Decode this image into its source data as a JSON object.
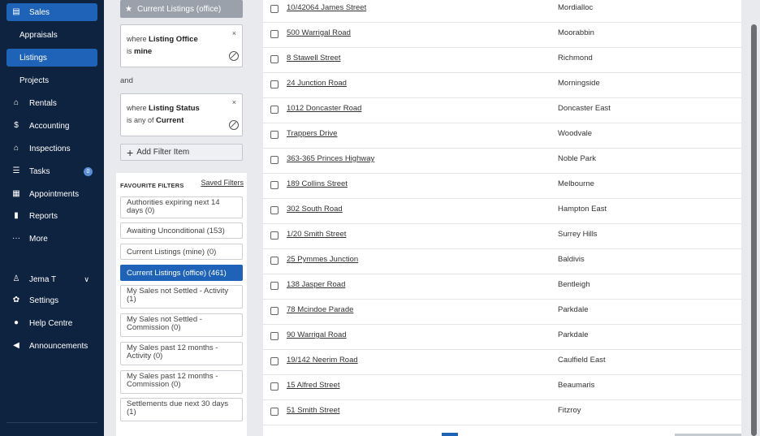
{
  "sidebar": {
    "items": [
      {
        "label": "Sales",
        "icon": "sales-icon",
        "glyph": "▤",
        "active": true
      },
      {
        "label": "Appraisals",
        "sub": true
      },
      {
        "label": "Listings",
        "sub": true,
        "active": true
      },
      {
        "label": "Projects",
        "sub": true
      },
      {
        "label": "Rentals",
        "icon": "home-icon",
        "glyph": "⌂"
      },
      {
        "label": "Accounting",
        "icon": "dollar-icon",
        "glyph": "$"
      },
      {
        "label": "Inspections",
        "icon": "inspection-icon",
        "glyph": "⌂"
      },
      {
        "label": "Tasks",
        "icon": "tasks-icon",
        "glyph": "☰",
        "badge": "0"
      },
      {
        "label": "Appointments",
        "icon": "calendar-icon",
        "glyph": "▦"
      },
      {
        "label": "Reports",
        "icon": "bar-chart-icon",
        "glyph": "▮"
      },
      {
        "label": "More",
        "icon": "ellipsis-icon",
        "glyph": "···"
      }
    ],
    "user": {
      "label": "Jema T",
      "icon": "user-icon",
      "glyph": "♙"
    },
    "settings": {
      "label": "Settings",
      "icon": "gear-icon",
      "glyph": "✿"
    },
    "help": {
      "label": "Help Centre",
      "icon": "help-icon",
      "glyph": "●"
    },
    "announcements": {
      "label": "Announcements",
      "icon": "megaphone-icon",
      "glyph": "◀"
    }
  },
  "filters": {
    "current_filter": "Current Listings (office)",
    "conditions": [
      {
        "where": "where",
        "field": "Listing Office",
        "op": "is",
        "value": "mine"
      },
      {
        "where": "where",
        "field": "Listing Status",
        "op": "is any of",
        "value": "Current"
      }
    ],
    "and_label": "and",
    "add_label": "Add Filter Item",
    "favourites_title": "FAVOURITE FILTERS",
    "saved_filters_link": "Saved Filters",
    "favourites": [
      {
        "label": "Authorities expiring next 14 days (0)"
      },
      {
        "label": "Awaiting Unconditional (153)"
      },
      {
        "label": "Current Listings (mine) (0)"
      },
      {
        "label": "Current Listings (office) (461)",
        "active": true
      },
      {
        "label": "My Sales not Settled - Activity (1)"
      },
      {
        "label": "My Sales not Settled - Commission (0)"
      },
      {
        "label": "My Sales past 12 months - Activity (0)"
      },
      {
        "label": "My Sales past 12 months - Commission (0)"
      },
      {
        "label": "Settlements due next 30 days (1)"
      }
    ]
  },
  "listings": [
    {
      "address": "10/42064 James Street",
      "suburb": "Mordialloc"
    },
    {
      "address": "500 Warrigal Road",
      "suburb": "Moorabbin"
    },
    {
      "address": "8 Stawell Street",
      "suburb": "Richmond"
    },
    {
      "address": "24 Junction Road",
      "suburb": "Morningside"
    },
    {
      "address": "1012 Doncaster Road",
      "suburb": "Doncaster East"
    },
    {
      "address": "Trappers Drive",
      "suburb": "Woodvale"
    },
    {
      "address": "363-365 Princes Highway",
      "suburb": "Noble Park"
    },
    {
      "address": "189 Collins Street",
      "suburb": "Melbourne"
    },
    {
      "address": "302 South Road",
      "suburb": "Hampton East"
    },
    {
      "address": "1/20 Smith Street",
      "suburb": "Surrey Hills"
    },
    {
      "address": "25 Pymmes Junction",
      "suburb": "Baldivis"
    },
    {
      "address": "138 Jasper Road",
      "suburb": "Bentleigh"
    },
    {
      "address": "78 Mcindoe Parade",
      "suburb": "Parkdale"
    },
    {
      "address": "90 Warrigal Road",
      "suburb": "Parkdale"
    },
    {
      "address": "19/142 Neerim Road",
      "suburb": "Caulfield East"
    },
    {
      "address": "15 Alfred Street",
      "suburb": "Beaumaris"
    },
    {
      "address": "51 Smith Street",
      "suburb": "Fitzroy"
    }
  ]
}
